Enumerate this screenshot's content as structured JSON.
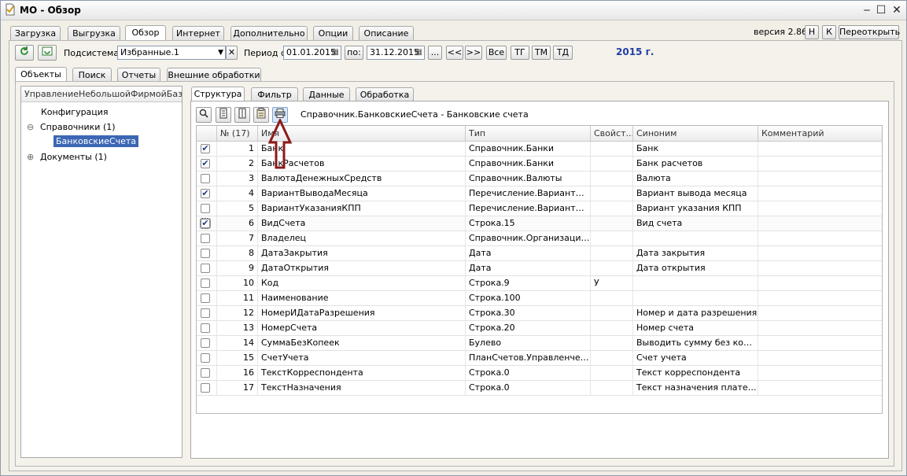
{
  "window": {
    "title": "МО - Обзор",
    "icon": "app-doc-icon",
    "minimize_glyph": "‒",
    "maximize_glyph": "☐",
    "close_glyph": "✕"
  },
  "main_tabs": [
    "Загрузка",
    "Выгрузка",
    "Обзор",
    "Интернет",
    "Дополнительно",
    "Опции",
    "Описание"
  ],
  "active_main_tab": "Обзор",
  "version": {
    "label": "версия 2.86",
    "btn_h": "Н",
    "btn_k": "К",
    "reopen": "Переоткрыть"
  },
  "toolbar": {
    "subsystem_label": "Подсистема:",
    "subsystem_value": "Избранные.1",
    "period_label": "Период с:",
    "date_from": "01.01.2015",
    "to_label": "по:",
    "date_to": "31.12.2015",
    "dots": "...",
    "prev": "<<",
    "next": ">>",
    "all": "Все",
    "tg": "ТГ",
    "tm": "ТМ",
    "td": "ТД",
    "year": "2015 г.",
    "year_color": "#1f3fa8"
  },
  "sub_tabs": [
    "Объекты",
    "Поиск",
    "Отчеты",
    "Внешние обработки"
  ],
  "tree": {
    "header": "УправлениеНебольшойФирмойБаз...",
    "items": [
      {
        "label": "Конфигурация"
      },
      {
        "label": "Справочники (1)",
        "expander": "⊖"
      },
      {
        "label": "БанковскиеСчета"
      },
      {
        "label": "Документы (1)",
        "expander": "⊕"
      }
    ]
  },
  "detail_tabs": [
    "Структура",
    "Фильтр",
    "Данные",
    "Обработка"
  ],
  "object_path": "Справочник.БанковскиеСчета - Банковские счета",
  "grid": {
    "columns": [
      "",
      "№ (17)",
      "Имя",
      "Тип",
      "Свойст...",
      "Синоним",
      "Комментарий"
    ],
    "rows": [
      {
        "checked": true,
        "n": "1",
        "name": "Банк",
        "type": "Справочник.Банки",
        "prop": "",
        "syn": "Банк"
      },
      {
        "checked": true,
        "n": "2",
        "name": "БанкРасчетов",
        "type": "Справочник.Банки",
        "prop": "",
        "syn": "Банк расчетов"
      },
      {
        "checked": false,
        "n": "3",
        "name": "ВалютаДенежныхСредств",
        "type": "Справочник.Валюты",
        "prop": "",
        "syn": "Валюта"
      },
      {
        "checked": true,
        "n": "4",
        "name": "ВариантВыводаМесяца",
        "type": "Перечисление.ВариантыВы...",
        "prop": "",
        "syn": "Вариант вывода месяца"
      },
      {
        "checked": false,
        "n": "5",
        "name": "ВариантУказанияКПП",
        "type": "Перечисление.ВариантыУк...",
        "prop": "",
        "syn": "Вариант указания КПП"
      },
      {
        "checked": true,
        "n": "6",
        "name": "ВидСчета",
        "type": "Строка.15",
        "prop": "",
        "syn": "Вид счета"
      },
      {
        "checked": false,
        "n": "7",
        "name": "Владелец",
        "type": "Справочник.Организации,С...",
        "prop": "",
        "syn": ""
      },
      {
        "checked": false,
        "n": "8",
        "name": "ДатаЗакрытия",
        "type": "Дата",
        "prop": "",
        "syn": "Дата закрытия"
      },
      {
        "checked": false,
        "n": "9",
        "name": "ДатаОткрытия",
        "type": "Дата",
        "prop": "",
        "syn": "Дата открытия"
      },
      {
        "checked": false,
        "n": "10",
        "name": "Код",
        "type": "Строка.9",
        "prop": "У",
        "syn": ""
      },
      {
        "checked": false,
        "n": "11",
        "name": "Наименование",
        "type": "Строка.100",
        "prop": "",
        "syn": ""
      },
      {
        "checked": false,
        "n": "12",
        "name": "НомерИДатаРазрешения",
        "type": "Строка.30",
        "prop": "",
        "syn": "Номер и дата разрешения"
      },
      {
        "checked": false,
        "n": "13",
        "name": "НомерСчета",
        "type": "Строка.20",
        "prop": "",
        "syn": "Номер счета"
      },
      {
        "checked": false,
        "n": "14",
        "name": "СуммаБезКопеек",
        "type": "Булево",
        "prop": "",
        "syn": "Выводить сумму без копее..."
      },
      {
        "checked": false,
        "n": "15",
        "name": "СчетУчета",
        "type": "ПланСчетов.Управленческий",
        "prop": "",
        "syn": "Счет учета"
      },
      {
        "checked": false,
        "n": "16",
        "name": "ТекстКорреспондента",
        "type": "Строка.0",
        "prop": "",
        "syn": "Текст корреспондента"
      },
      {
        "checked": false,
        "n": "17",
        "name": "ТекстНазначения",
        "type": "Строка.0",
        "prop": "",
        "syn": "Текст назначения платежа"
      }
    ]
  },
  "icons": {
    "refresh": "refresh-icon",
    "settings": "window-settings-icon",
    "search": "search-icon",
    "print": "print-icon",
    "arrow": "up-arrow-annotation-icon"
  },
  "colors": {
    "selection": "#3c67b4",
    "arrow": "#8b1a1a",
    "checkmark": "#1c3b8a"
  }
}
